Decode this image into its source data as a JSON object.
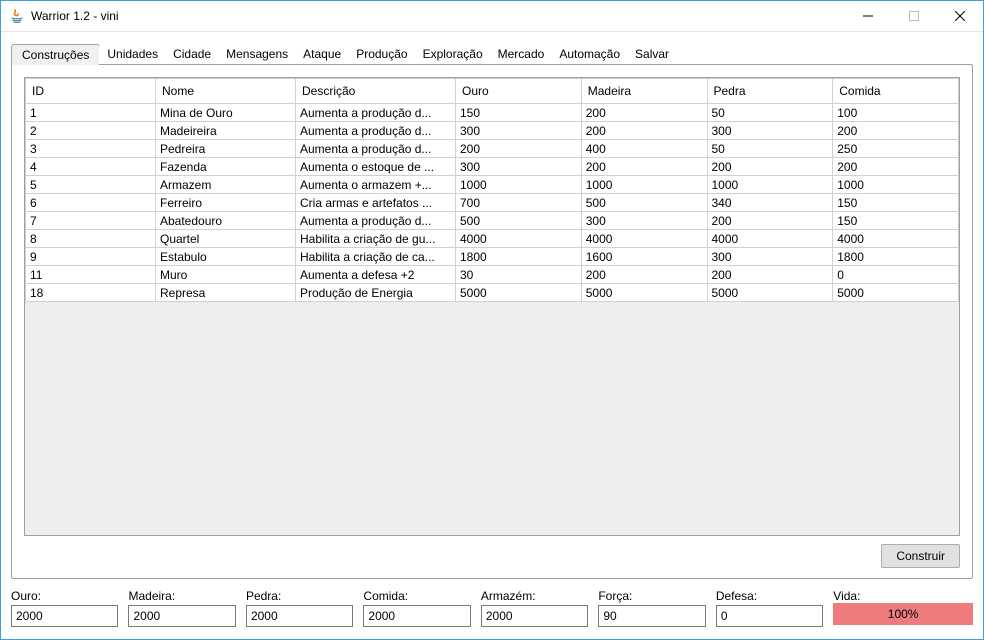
{
  "window": {
    "title": "Warrior 1.2 - vini"
  },
  "tabs": [
    {
      "label": "Construções",
      "active": true
    },
    {
      "label": "Unidades"
    },
    {
      "label": "Cidade"
    },
    {
      "label": "Mensagens"
    },
    {
      "label": "Ataque"
    },
    {
      "label": "Produção"
    },
    {
      "label": "Exploração"
    },
    {
      "label": "Mercado"
    },
    {
      "label": "Automação"
    },
    {
      "label": "Salvar"
    }
  ],
  "table": {
    "columns": [
      "ID",
      "Nome",
      "Descrição",
      "Ouro",
      "Madeira",
      "Pedra",
      "Comida"
    ],
    "rows": [
      [
        "1",
        "Mina de Ouro",
        "Aumenta a produção d...",
        "150",
        "200",
        "50",
        "100"
      ],
      [
        "2",
        "Madeireira",
        "Aumenta a produção d...",
        "300",
        "200",
        "300",
        "200"
      ],
      [
        "3",
        "Pedreira",
        "Aumenta a produção d...",
        "200",
        "400",
        "50",
        "250"
      ],
      [
        "4",
        "Fazenda",
        "Aumenta o estoque de ...",
        "300",
        "200",
        "200",
        "200"
      ],
      [
        "5",
        "Armazem",
        "Aumenta o armazem +...",
        "1000",
        "1000",
        "1000",
        "1000"
      ],
      [
        "6",
        "Ferreiro",
        "Cria armas e artefatos ...",
        "700",
        "500",
        "340",
        "150"
      ],
      [
        "7",
        "Abatedouro",
        "Aumenta a produção d...",
        "500",
        "300",
        "200",
        "150"
      ],
      [
        "8",
        "Quartel",
        "Habilita a criação de gu...",
        "4000",
        "4000",
        "4000",
        "4000"
      ],
      [
        "9",
        "Estabulo",
        "Habilita a criação de ca...",
        "1800",
        "1600",
        "300",
        "1800"
      ],
      [
        "11",
        "Muro",
        "Aumenta a defesa +2",
        "30",
        "200",
        "200",
        "0"
      ],
      [
        "18",
        "Represa",
        "Produção de Energia",
        "5000",
        "5000",
        "5000",
        "5000"
      ]
    ]
  },
  "buttons": {
    "construir": "Construir"
  },
  "status": {
    "ouro": {
      "label": "Ouro:",
      "value": "2000"
    },
    "madeira": {
      "label": "Madeira:",
      "value": "2000"
    },
    "pedra": {
      "label": "Pedra:",
      "value": "2000"
    },
    "comida": {
      "label": "Comida:",
      "value": "2000"
    },
    "armazem": {
      "label": "Armazém:",
      "value": "2000"
    },
    "forca": {
      "label": "Força:",
      "value": "90"
    },
    "defesa": {
      "label": "Defesa:",
      "value": "0"
    },
    "vida": {
      "label": "Vida:",
      "value": "100%"
    }
  }
}
